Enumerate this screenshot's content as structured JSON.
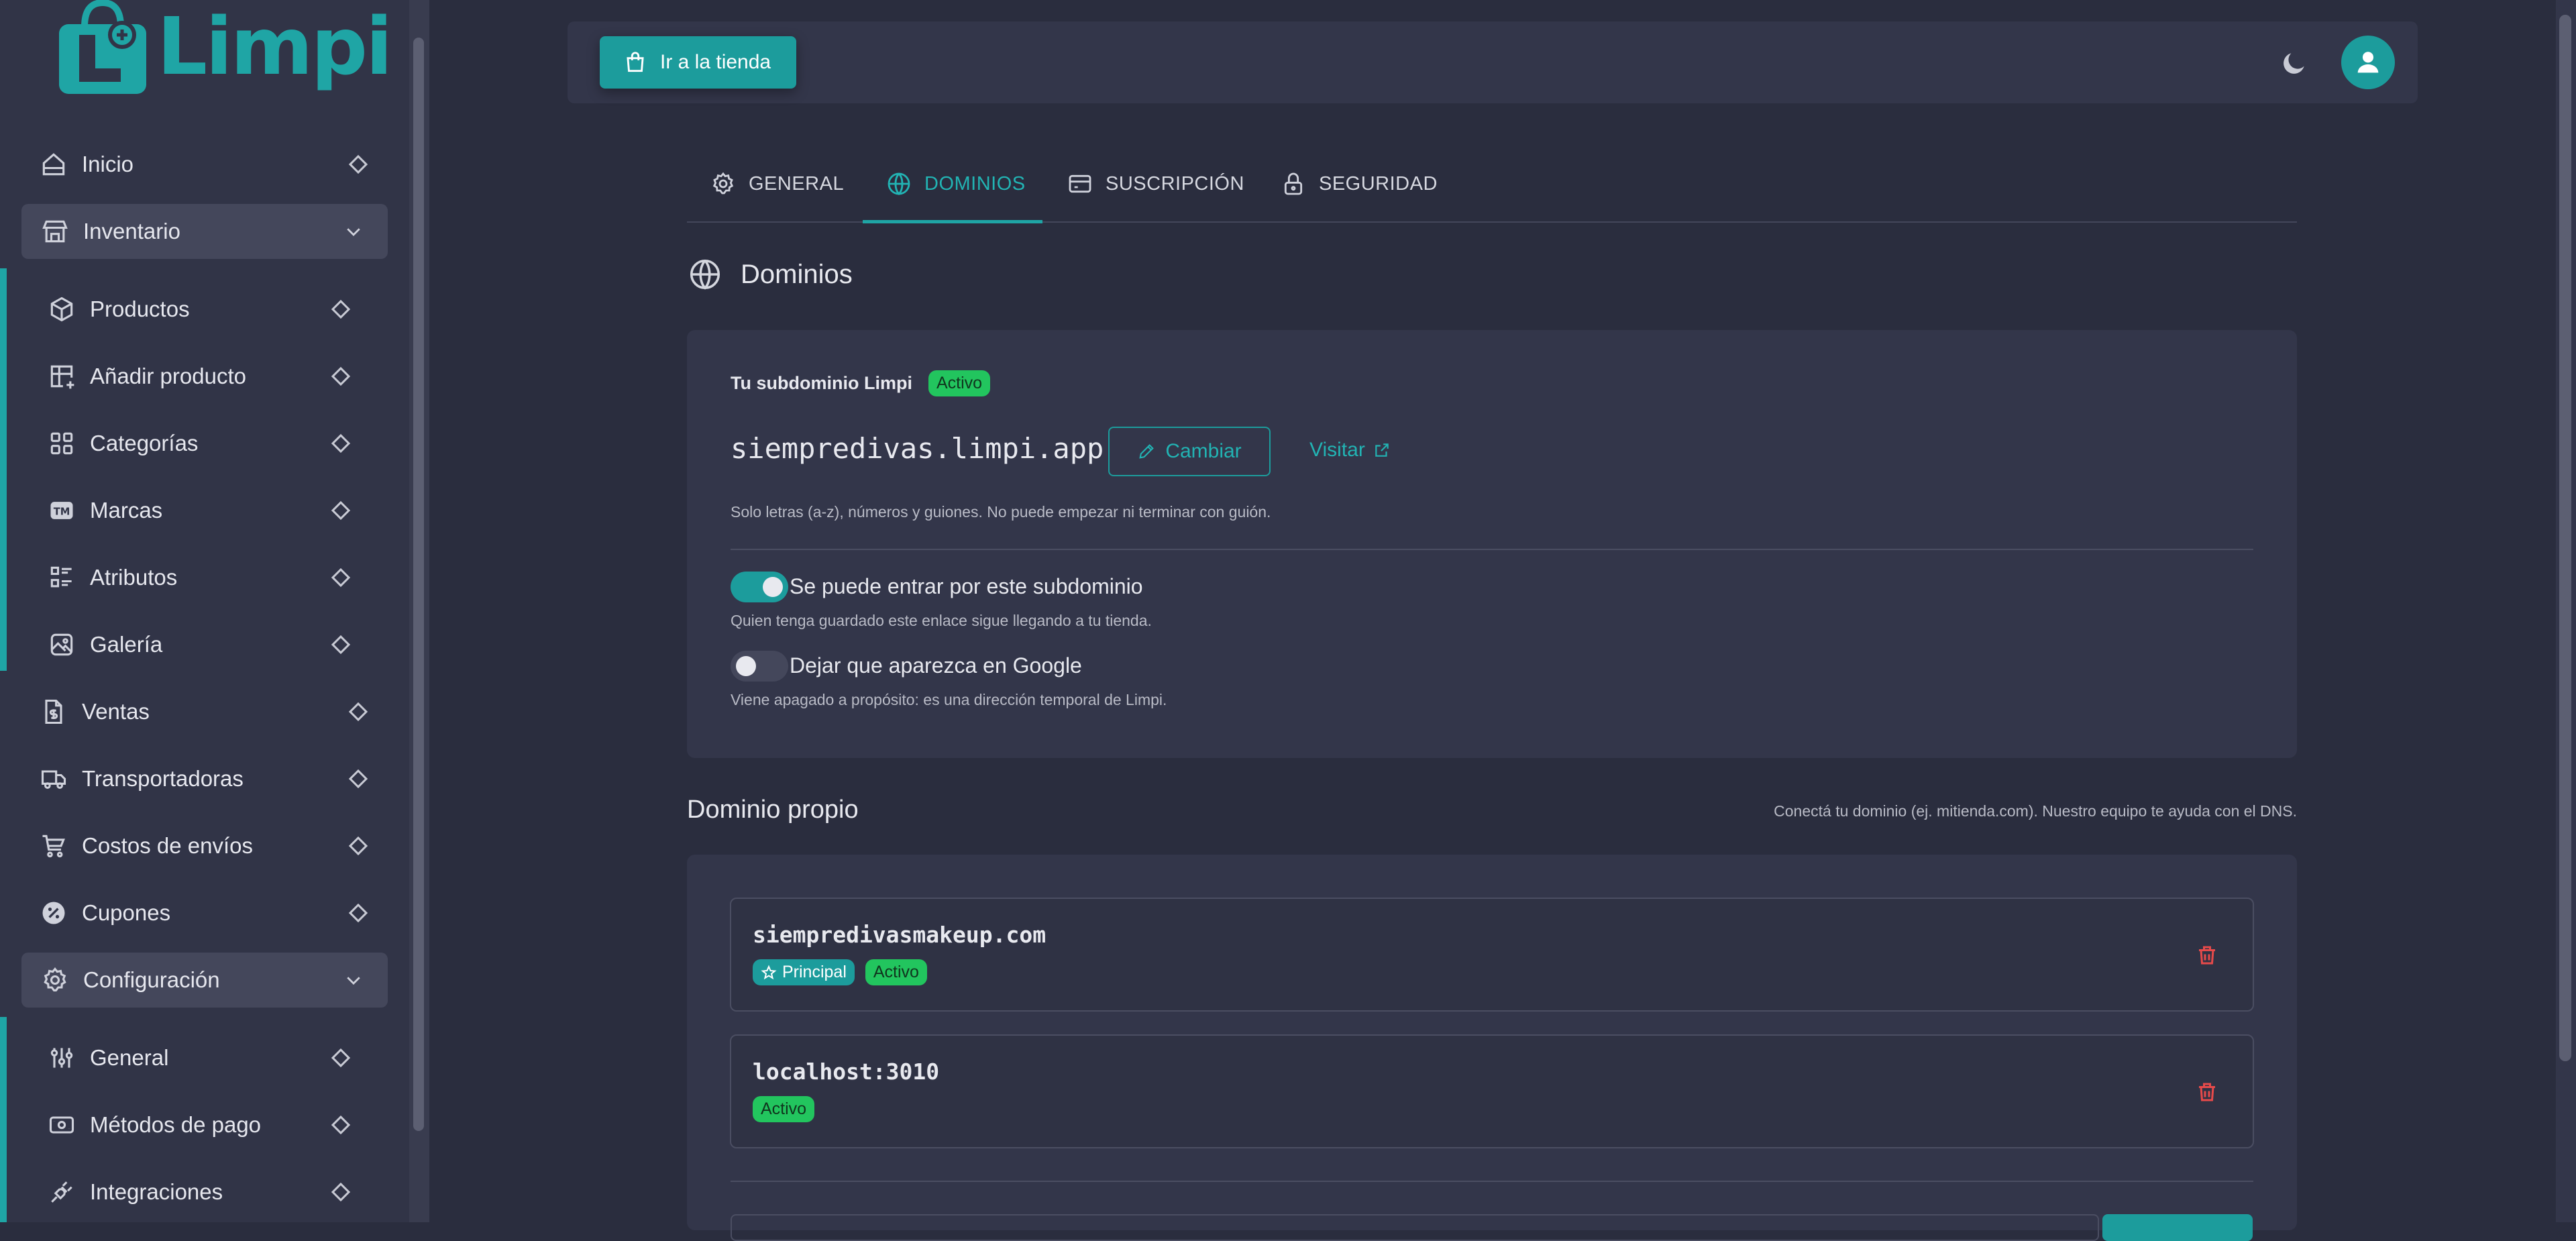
{
  "brand": {
    "name": "Limpi",
    "color": "#1fa5a5"
  },
  "sidebar": {
    "items": [
      {
        "label": "Inicio",
        "icon": "home-icon"
      },
      {
        "label": "Inventario",
        "icon": "store-icon",
        "expanded": true
      },
      {
        "label": "Productos",
        "icon": "box-icon"
      },
      {
        "label": "Añadir producto",
        "icon": "table-plus-icon"
      },
      {
        "label": "Categorías",
        "icon": "category-grid-icon"
      },
      {
        "label": "Marcas",
        "icon": "trademark-icon"
      },
      {
        "label": "Atributos",
        "icon": "list-details-icon"
      },
      {
        "label": "Galería",
        "icon": "photo-icon"
      },
      {
        "label": "Ventas",
        "icon": "receipt-dollar-icon"
      },
      {
        "label": "Transportadoras",
        "icon": "truck-icon"
      },
      {
        "label": "Costos de envíos",
        "icon": "cart-cost-icon"
      },
      {
        "label": "Cupones",
        "icon": "discount-icon"
      },
      {
        "label": "Configuración",
        "icon": "settings-icon",
        "expanded": true
      },
      {
        "label": "General",
        "icon": "sliders-icon"
      },
      {
        "label": "Métodos de pago",
        "icon": "cash-icon"
      },
      {
        "label": "Integraciones",
        "icon": "plug-icon"
      }
    ]
  },
  "topbar": {
    "store_button": "Ir a la tienda"
  },
  "tabs": [
    {
      "label": "GENERAL",
      "active": false
    },
    {
      "label": "DOMINIOS",
      "active": true
    },
    {
      "label": "SUSCRIPCIÓN",
      "active": false
    },
    {
      "label": "SEGURIDAD",
      "active": false
    }
  ],
  "domains": {
    "title": "Dominios",
    "subdomain": {
      "heading": "Tu subdominio Limpi",
      "status": "Activo",
      "value": "siempredivas.limpi.app",
      "change_label": "Cambiar",
      "visit_label": "Visitar",
      "hint": "Solo letras (a-z), números y guiones. No puede empezar ni terminar con guión.",
      "toggle_enter": {
        "label": "Se puede entrar por este subdominio",
        "on": true,
        "description": "Quien tenga guardado este enlace sigue llegando a tu tienda."
      },
      "toggle_google": {
        "label": "Dejar que aparezca en Google",
        "on": false,
        "description": "Viene apagado a propósito: es una dirección temporal de Limpi."
      }
    },
    "custom": {
      "title": "Dominio propio",
      "hint": "Conectá tu dominio (ej. mitienda.com). Nuestro equipo te ayuda con el DNS.",
      "list": [
        {
          "domain": "siempredivasmakeup.com",
          "primary_label": "Principal",
          "status": "Activo"
        },
        {
          "domain": "localhost:3010",
          "status": "Activo"
        }
      ]
    }
  },
  "colors": {
    "accent": "#1c9c9c",
    "active_green": "#22c55e",
    "danger": "#e74a4a"
  }
}
